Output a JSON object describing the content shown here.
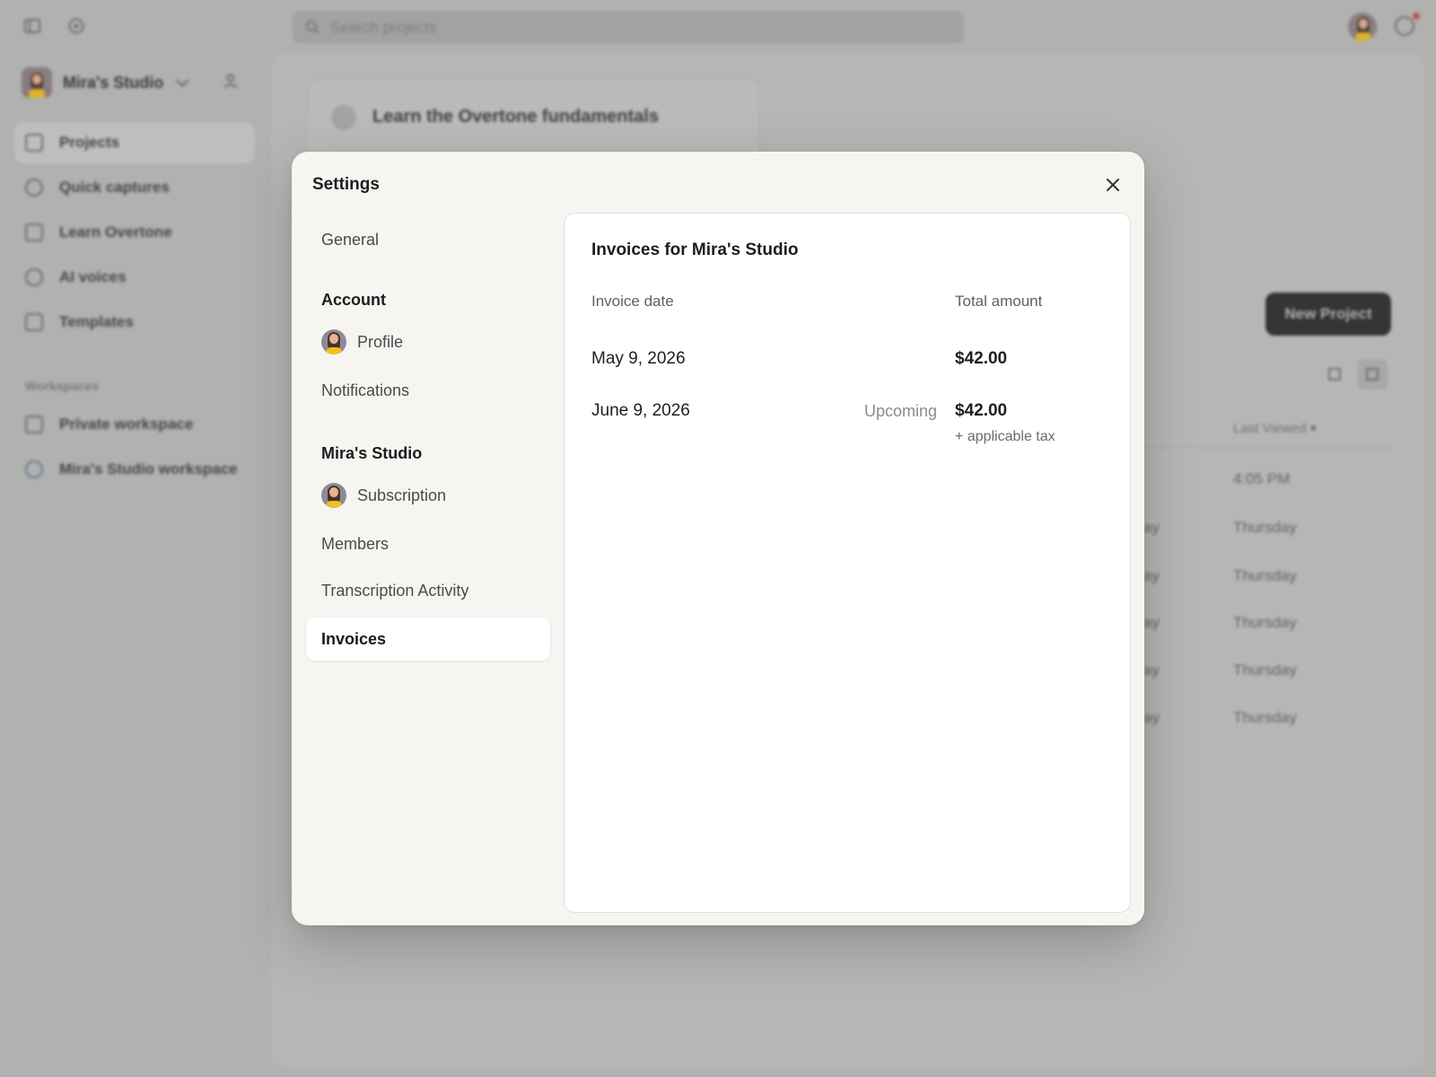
{
  "background": {
    "search_placeholder": "Search projects",
    "workspace_name": "Mira's Studio",
    "nav": [
      {
        "label": "Projects"
      },
      {
        "label": "Quick captures"
      },
      {
        "label": "Learn Overtone"
      },
      {
        "label": "AI voices"
      },
      {
        "label": "Templates"
      }
    ],
    "workspaces_section": "Workspaces",
    "workspaces": [
      {
        "label": "Private workspace"
      },
      {
        "label": "Mira's Studio workspace"
      }
    ],
    "learn_card_title": "Learn the Overtone fundamentals",
    "new_project_label": "New Project",
    "last_viewed_header": "Last Viewed",
    "last_viewed": [
      "4:05 PM",
      "Thursday",
      "Thursday",
      "Thursday",
      "Thursday",
      "Thursday"
    ],
    "partial_cells": [
      "ay",
      "ay",
      "ay",
      "ay",
      "ay"
    ]
  },
  "modal": {
    "title": "Settings",
    "nav": {
      "general": "General",
      "account_section": "Account",
      "profile": "Profile",
      "notifications": "Notifications",
      "studio_section": "Mira's Studio",
      "subscription": "Subscription",
      "members": "Members",
      "transcription": "Transcription Activity",
      "invoices": "Invoices"
    },
    "panel": {
      "title": "Invoices for Mira's Studio",
      "columns": {
        "date": "Invoice date",
        "amount": "Total amount"
      },
      "rows": [
        {
          "date": "May 9, 2026",
          "status": "",
          "amount": "$42.00",
          "note": ""
        },
        {
          "date": "June 9, 2026",
          "status": "Upcoming",
          "amount": "$42.00",
          "note": "+ applicable tax"
        }
      ]
    }
  },
  "colors": {
    "overlay": "#bdbdbc",
    "modal_bg": "#f6f5f2",
    "panel_bg": "#ffffff",
    "notification_dot": "#c84c4c"
  }
}
